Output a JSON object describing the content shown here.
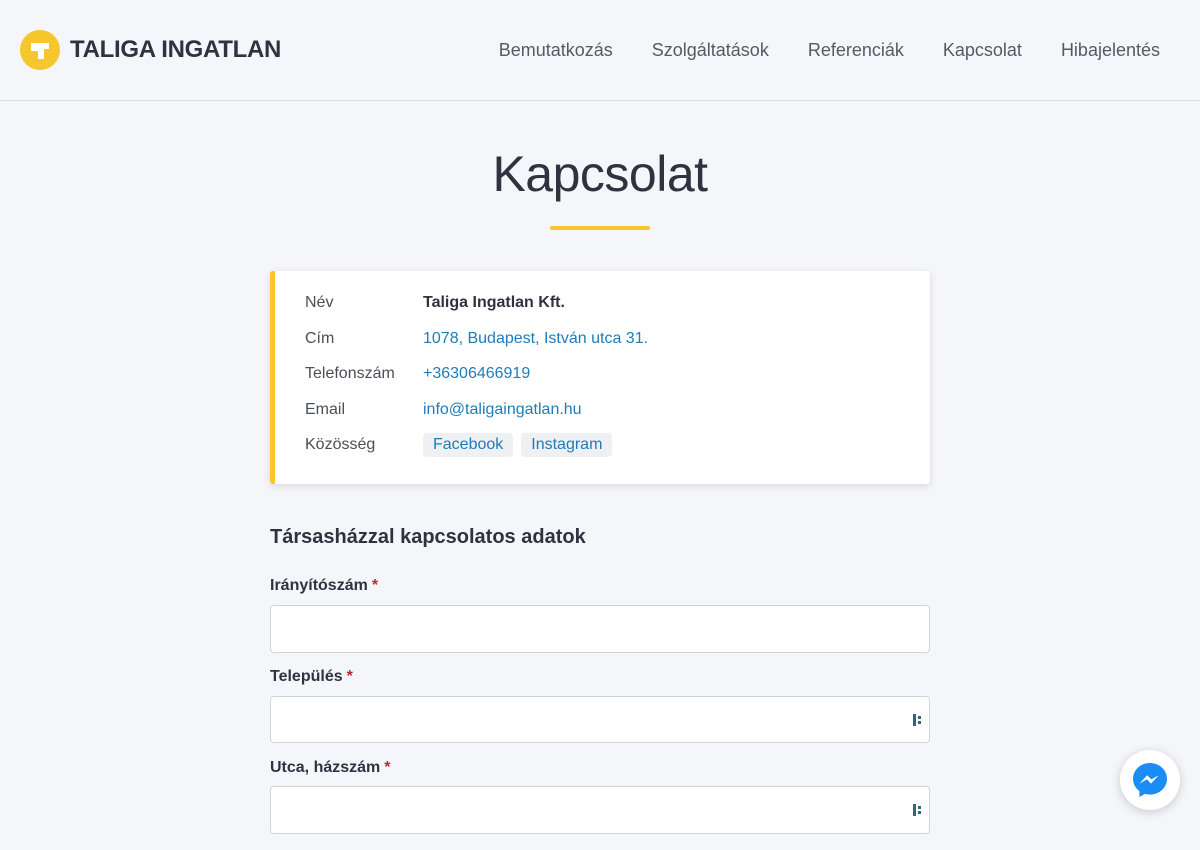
{
  "header": {
    "logo_text": "TALIGA INGATLAN",
    "logo_icon": "taliga-t-icon",
    "nav": [
      {
        "label": "Bemutatkozás"
      },
      {
        "label": "Szolgáltatások"
      },
      {
        "label": "Referenciák"
      },
      {
        "label": "Kapcsolat"
      },
      {
        "label": "Hibajelentés"
      }
    ]
  },
  "page": {
    "title": "Kapcsolat"
  },
  "contact": {
    "name_label": "Név",
    "name_value": "Taliga Ingatlan Kft.",
    "address_label": "Cím",
    "address_value": "1078, Budapest, István utca 31.",
    "phone_label": "Telefonszám",
    "phone_value": "+36306466919",
    "email_label": "Email",
    "email_value": "info@taligaingatlan.hu",
    "community_label": "Közösség",
    "facebook_label": "Facebook",
    "instagram_label": "Instagram"
  },
  "form": {
    "section_title": "Társasházzal kapcsolatos adatok",
    "required_mark": "*",
    "fields": [
      {
        "label": "Irányítószám",
        "value": "",
        "autofill_icon": false
      },
      {
        "label": "Település",
        "value": "",
        "autofill_icon": true
      },
      {
        "label": "Utca, házszám",
        "value": "",
        "autofill_icon": true
      }
    ]
  },
  "widgets": {
    "messenger_icon": "messenger-icon"
  },
  "colors": {
    "accent": "#f6c62d",
    "link": "#1f7cb8",
    "background": "#f5f6fa",
    "required": "#c0262d",
    "messenger": "#1a8cf5"
  }
}
